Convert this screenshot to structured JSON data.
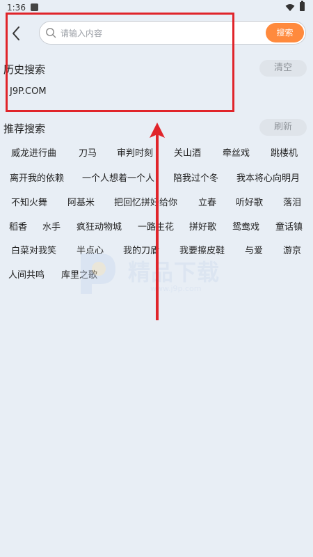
{
  "status_bar": {
    "time": "1:36"
  },
  "search": {
    "placeholder": "请输入内容",
    "value": "",
    "button_label": "搜索"
  },
  "history": {
    "title": "历史搜索",
    "clear_label": "清空",
    "items": [
      "J9P.COM"
    ]
  },
  "recommend": {
    "title": "推荐搜索",
    "refresh_label": "刷新",
    "tags": [
      "威龙进行曲",
      "刀马",
      "审判时刻",
      "关山酒",
      "牵丝戏",
      "跳楼机",
      "离开我的依赖",
      "一个人想着一个人",
      "陪我过个冬",
      "我本将心向明月",
      "不知火舞",
      "阿基米",
      "把回忆拼好给你",
      "立春",
      "听好歌",
      "落泪",
      "稻香",
      "水手",
      "疯狂动物城",
      "一路生花",
      "拼好歌",
      "鸳鸯戏",
      "童话镇",
      "白菜对我笑",
      "半点心",
      "我的刀盾",
      "我要擦皮鞋",
      "与爱",
      "游京",
      "人间共鸣",
      "库里之歌"
    ]
  },
  "watermark": {
    "title": "精品下载",
    "subtitle": "www.j9p.com"
  },
  "colors": {
    "accent": "#ff8a3d",
    "annotation": "#e0242a",
    "background": "#e8eef5"
  },
  "icons": {
    "back": "chevron-left-icon",
    "search": "search-icon",
    "wifi": "wifi-icon",
    "battery": "battery-icon"
  }
}
